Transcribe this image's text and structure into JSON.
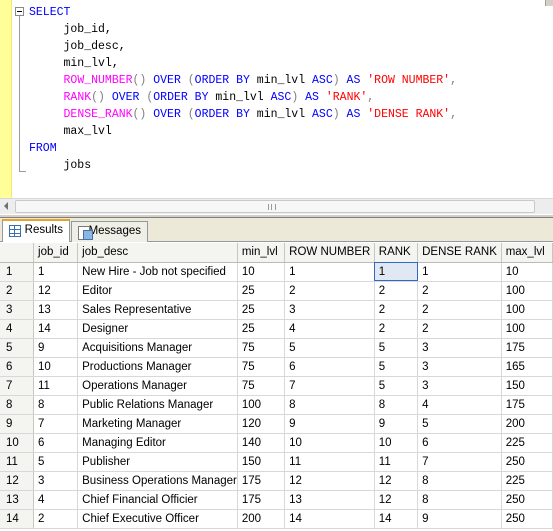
{
  "editor": {
    "lines": [
      [
        {
          "t": "SELECT",
          "c": "kw"
        }
      ],
      [
        {
          "t": "     job_id,",
          "c": "id"
        }
      ],
      [
        {
          "t": "     job_desc,",
          "c": "id"
        }
      ],
      [
        {
          "t": "     min_lvl,",
          "c": "id"
        }
      ],
      [
        {
          "t": "     ",
          "c": "id"
        },
        {
          "t": "ROW_NUMBER",
          "c": "fn"
        },
        {
          "t": "() ",
          "c": "op"
        },
        {
          "t": "OVER ",
          "c": "kw"
        },
        {
          "t": "(",
          "c": "op"
        },
        {
          "t": "ORDER BY ",
          "c": "kw"
        },
        {
          "t": "min_lvl ",
          "c": "id"
        },
        {
          "t": "ASC",
          "c": "kw"
        },
        {
          "t": ") ",
          "c": "op"
        },
        {
          "t": "AS ",
          "c": "kw"
        },
        {
          "t": "'ROW NUMBER'",
          "c": "str"
        },
        {
          "t": ",",
          "c": "op"
        }
      ],
      [
        {
          "t": "     ",
          "c": "id"
        },
        {
          "t": "RANK",
          "c": "fn"
        },
        {
          "t": "() ",
          "c": "op"
        },
        {
          "t": "OVER ",
          "c": "kw"
        },
        {
          "t": "(",
          "c": "op"
        },
        {
          "t": "ORDER BY ",
          "c": "kw"
        },
        {
          "t": "min_lvl ",
          "c": "id"
        },
        {
          "t": "ASC",
          "c": "kw"
        },
        {
          "t": ") ",
          "c": "op"
        },
        {
          "t": "AS ",
          "c": "kw"
        },
        {
          "t": "'RANK'",
          "c": "str"
        },
        {
          "t": ",",
          "c": "op"
        }
      ],
      [
        {
          "t": "     ",
          "c": "id"
        },
        {
          "t": "DENSE_RANK",
          "c": "fn"
        },
        {
          "t": "() ",
          "c": "op"
        },
        {
          "t": "OVER ",
          "c": "kw"
        },
        {
          "t": "(",
          "c": "op"
        },
        {
          "t": "ORDER BY ",
          "c": "kw"
        },
        {
          "t": "min_lvl ",
          "c": "id"
        },
        {
          "t": "ASC",
          "c": "kw"
        },
        {
          "t": ") ",
          "c": "op"
        },
        {
          "t": "AS ",
          "c": "kw"
        },
        {
          "t": "'DENSE RANK'",
          "c": "str"
        },
        {
          "t": ",",
          "c": "op"
        }
      ],
      [
        {
          "t": "     max_lvl",
          "c": "id"
        }
      ],
      [
        {
          "t": "FROM",
          "c": "kw"
        }
      ],
      [
        {
          "t": "     jobs",
          "c": "id"
        }
      ]
    ]
  },
  "tabs": [
    {
      "label": "Results",
      "icon": "grid-icon",
      "active": true
    },
    {
      "label": "Messages",
      "icon": "messages-icon",
      "active": false
    }
  ],
  "grid": {
    "columns": [
      "job_id",
      "job_desc",
      "min_lvl",
      "ROW NUMBER",
      "RANK",
      "DENSE RANK",
      "max_lvl"
    ],
    "rows": [
      [
        "1",
        "1",
        "New Hire - Job not specified",
        "10",
        "1",
        "1",
        "1",
        "10"
      ],
      [
        "2",
        "12",
        "Editor",
        "25",
        "2",
        "2",
        "2",
        "100"
      ],
      [
        "3",
        "13",
        "Sales Representative",
        "25",
        "3",
        "2",
        "2",
        "100"
      ],
      [
        "4",
        "14",
        "Designer",
        "25",
        "4",
        "2",
        "2",
        "100"
      ],
      [
        "5",
        "9",
        "Acquisitions Manager",
        "75",
        "5",
        "5",
        "3",
        "175"
      ],
      [
        "6",
        "10",
        "Productions Manager",
        "75",
        "6",
        "5",
        "3",
        "165"
      ],
      [
        "7",
        "11",
        "Operations Manager",
        "75",
        "7",
        "5",
        "3",
        "150"
      ],
      [
        "8",
        "8",
        "Public Relations Manager",
        "100",
        "8",
        "8",
        "4",
        "175"
      ],
      [
        "9",
        "7",
        "Marketing Manager",
        "120",
        "9",
        "9",
        "5",
        "200"
      ],
      [
        "10",
        "6",
        "Managing Editor",
        "140",
        "10",
        "10",
        "6",
        "225"
      ],
      [
        "11",
        "5",
        "Publisher",
        "150",
        "11",
        "11",
        "7",
        "250"
      ],
      [
        "12",
        "3",
        "Business Operations Manager",
        "175",
        "12",
        "12",
        "8",
        "225"
      ],
      [
        "13",
        "4",
        "Chief Financial Officier",
        "175",
        "13",
        "12",
        "8",
        "250"
      ],
      [
        "14",
        "2",
        "Chief Executive Officer",
        "200",
        "14",
        "14",
        "9",
        "250"
      ]
    ],
    "selected_cell": {
      "row": 0,
      "column": "RANK"
    }
  }
}
